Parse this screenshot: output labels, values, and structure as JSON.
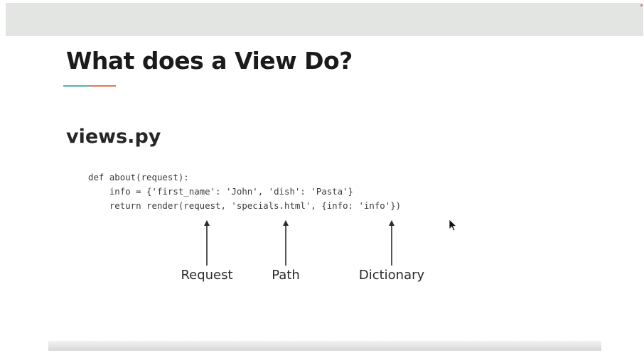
{
  "slide": {
    "title": "What does a View Do?",
    "file_name": "views.py",
    "code_lines": [
      "def about(request):",
      "    info = {'first_name': 'John', 'dish': 'Pasta'}",
      "    return render(request, 'specials.html', {info: 'info'})"
    ],
    "annotations": [
      {
        "label": "Request"
      },
      {
        "label": "Path"
      },
      {
        "label": "Dictionary"
      }
    ],
    "underline_colors": [
      "#4fb9a3",
      "#e8785a"
    ]
  },
  "icons": {
    "arrow": "up-arrow-icon",
    "cursor": "mouse-pointer-icon"
  }
}
